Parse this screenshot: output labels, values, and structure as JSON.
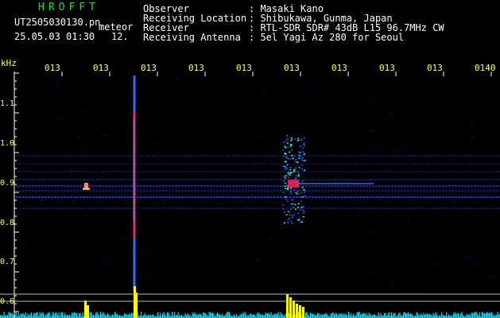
{
  "header": {
    "logo": "HROFFT",
    "filename": "UT2505030130.pn",
    "mode": "meteor",
    "datetime": "25.05.03 01:30",
    "level": "12.",
    "info": [
      {
        "label": "Observer",
        "value": ": Masaki Kano"
      },
      {
        "label": "Receiving Location",
        "value": ": Shibukawa, Gunma, Japan"
      },
      {
        "label": "Receiver",
        "value": ": RTL-SDR SDR# 43dB L15 96.7MHz CW"
      },
      {
        "label": "Receiving Antenna",
        "value": ": 5el Yagi Az 280 for Seoul"
      }
    ]
  },
  "axis": {
    "unit": "kHz",
    "x_ticks": [
      "013",
      "013",
      "013",
      "013",
      "013",
      "013",
      "013",
      "013",
      "013",
      "0140"
    ],
    "y_ticks": [
      "1.1",
      "1.0",
      "0.9",
      "0.8",
      "0.7",
      "0.6"
    ]
  },
  "colors": {
    "background": "#000000",
    "text": "#ffffff",
    "tick_labels": "#ffff55",
    "logo": "#22dd22",
    "noise": "#0a1a8c",
    "signal_hot": "#ff2060",
    "power_meter": "#00e0ff",
    "power_peak": "#ffff00"
  }
}
